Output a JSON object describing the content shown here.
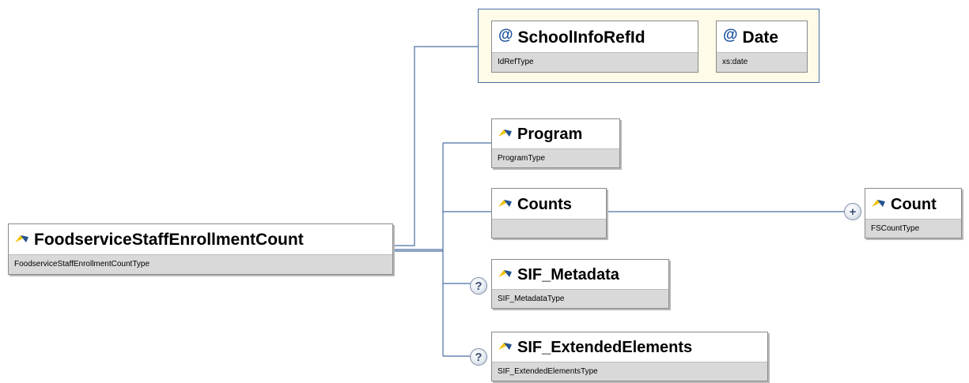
{
  "root": {
    "name": "FoodserviceStaffEnrollmentCount",
    "type": "FoodserviceStaffEnrollmentCountType"
  },
  "attributes": [
    {
      "symbol": "@",
      "name": "SchoolInfoRefId",
      "type": "IdRefType"
    },
    {
      "symbol": "@",
      "name": "Date",
      "type": "xs:date"
    }
  ],
  "elements": [
    {
      "name": "Program",
      "type": "ProgramType",
      "optional": false
    },
    {
      "name": "Counts",
      "type": "",
      "optional": false
    },
    {
      "name": "SIF_Metadata",
      "type": "SIF_MetadataType",
      "optional": true
    },
    {
      "name": "SIF_ExtendedElements",
      "type": "SIF_ExtendedElementsType",
      "optional": true
    }
  ],
  "count_child": {
    "name": "Count",
    "type": "FSCountType",
    "expand_symbol": "+"
  },
  "optional_symbol": "?",
  "colors": {
    "connector": "#4a6fa5",
    "attribute_group_fill": "#fefbe8",
    "type_bar": "#d9d9d9",
    "attribute_symbol": "#1a4f9c",
    "element_icon_yellow": "#f2c200",
    "element_icon_blue": "#1f4e8c"
  }
}
